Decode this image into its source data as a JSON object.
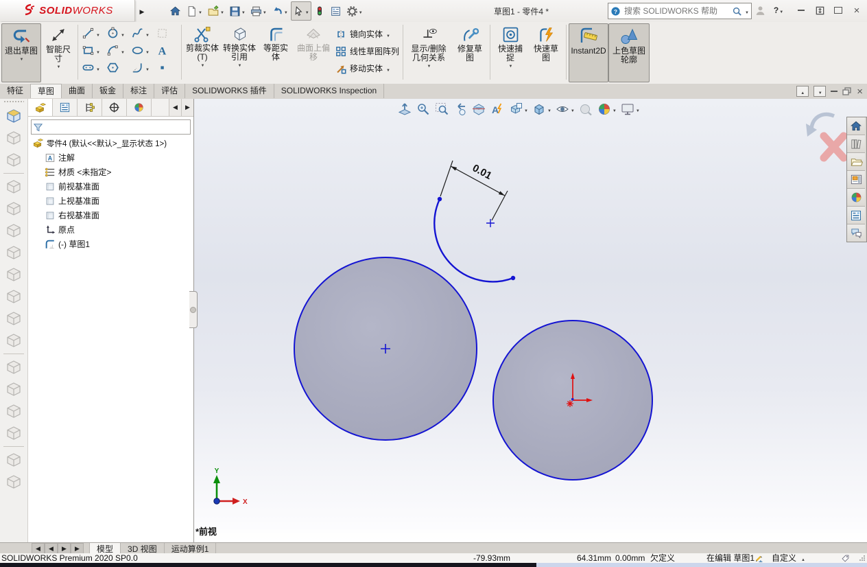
{
  "colors": {
    "brand_red": "#d6131c",
    "sketch_blue": "#1414d2",
    "circle_fill": "#a9abbe",
    "origin_red": "#e01010",
    "axis_green": "#0b8f0b",
    "dimension_black": "#1c1c1c",
    "chrome_gray": "#efedea"
  },
  "titlebar": {
    "title": "草图1 - 零件4 *",
    "brand_solid": "SOLID",
    "brand_works": "WORKS",
    "search_placeholder": "搜索 SOLIDWORKS 帮助",
    "icons": [
      "home",
      "new-document",
      "open-document",
      "save",
      "print",
      "undo",
      "select-cursor",
      "traffic-light",
      "properties",
      "options-gear",
      "search-help",
      "magnifier",
      "user",
      "help",
      "minimize",
      "expand",
      "maximize",
      "close"
    ]
  },
  "ribbon": {
    "exit_sketch": "退出草图",
    "smart_dimension": "智能尺寸",
    "trim": "剪裁实体(T)",
    "convert": "转换实体引用",
    "offset": "等距实体",
    "surface_offset": "曲面上偏移",
    "mirror": "镜向实体",
    "linear_pattern": "线性草图阵列",
    "move": "移动实体",
    "display_relations": "显示/删除几何关系",
    "repair": "修复草图",
    "quick_snaps": "快速捕捉",
    "quick_sketch": "快速草图",
    "instant2d": "Instant2D",
    "shaded_contours": "上色草图轮廓",
    "entity_icons": [
      "line",
      "circle",
      "spline",
      "rectangle",
      "arc",
      "ellipse",
      "text",
      "slot",
      "polygon",
      "sketch-fillet",
      "point"
    ]
  },
  "command_tabs": {
    "items": [
      "特征",
      "草图",
      "曲面",
      "钣金",
      "标注",
      "评估",
      "SOLIDWORKS 插件",
      "SOLIDWORKS Inspection"
    ],
    "active": "草图"
  },
  "feature_tree": {
    "root": "零件4 (默认<<默认>_显示状态 1>)",
    "items": [
      "注解",
      "材质 <未指定>",
      "前视基准面",
      "上视基准面",
      "右视基准面",
      "原点",
      "(-) 草图1"
    ],
    "tab_icons": [
      "features-manager",
      "property-manager",
      "configuration-manager",
      "dimxpert-manager",
      "display-manager"
    ]
  },
  "graphics": {
    "dimension_value": "0.01",
    "view_label": "*前视",
    "axis_x": "X",
    "axis_y": "Y",
    "headsup_icons": [
      "zoom-to-fit",
      "zoom-to-area",
      "zoom-to-selection",
      "previous-view",
      "section-view",
      "dynamic-annotation-views",
      "view-orientation",
      "display-style",
      "hide-show-items",
      "edit-appearance",
      "apply-scene",
      "view-settings"
    ],
    "taskpane_icons": [
      "home",
      "design-library",
      "file-explorer",
      "view-palette",
      "appearances",
      "custom-properties",
      "solidworks-forum"
    ],
    "confirmation_icons": [
      "exit-sketch-corner",
      "cancel-sketch-corner"
    ]
  },
  "bottom_tabs": {
    "items": [
      "模型",
      "3D 视图",
      "运动算例1"
    ],
    "active": "模型"
  },
  "statusbar": {
    "app_version": "SOLIDWORKS Premium 2020 SP0.0",
    "coord_x": "-79.93mm",
    "coord_y": "64.31mm",
    "coord_z": "0.00mm",
    "definition_state": "欠定义",
    "editing_state": "在编辑 草图1",
    "units": "自定义"
  }
}
